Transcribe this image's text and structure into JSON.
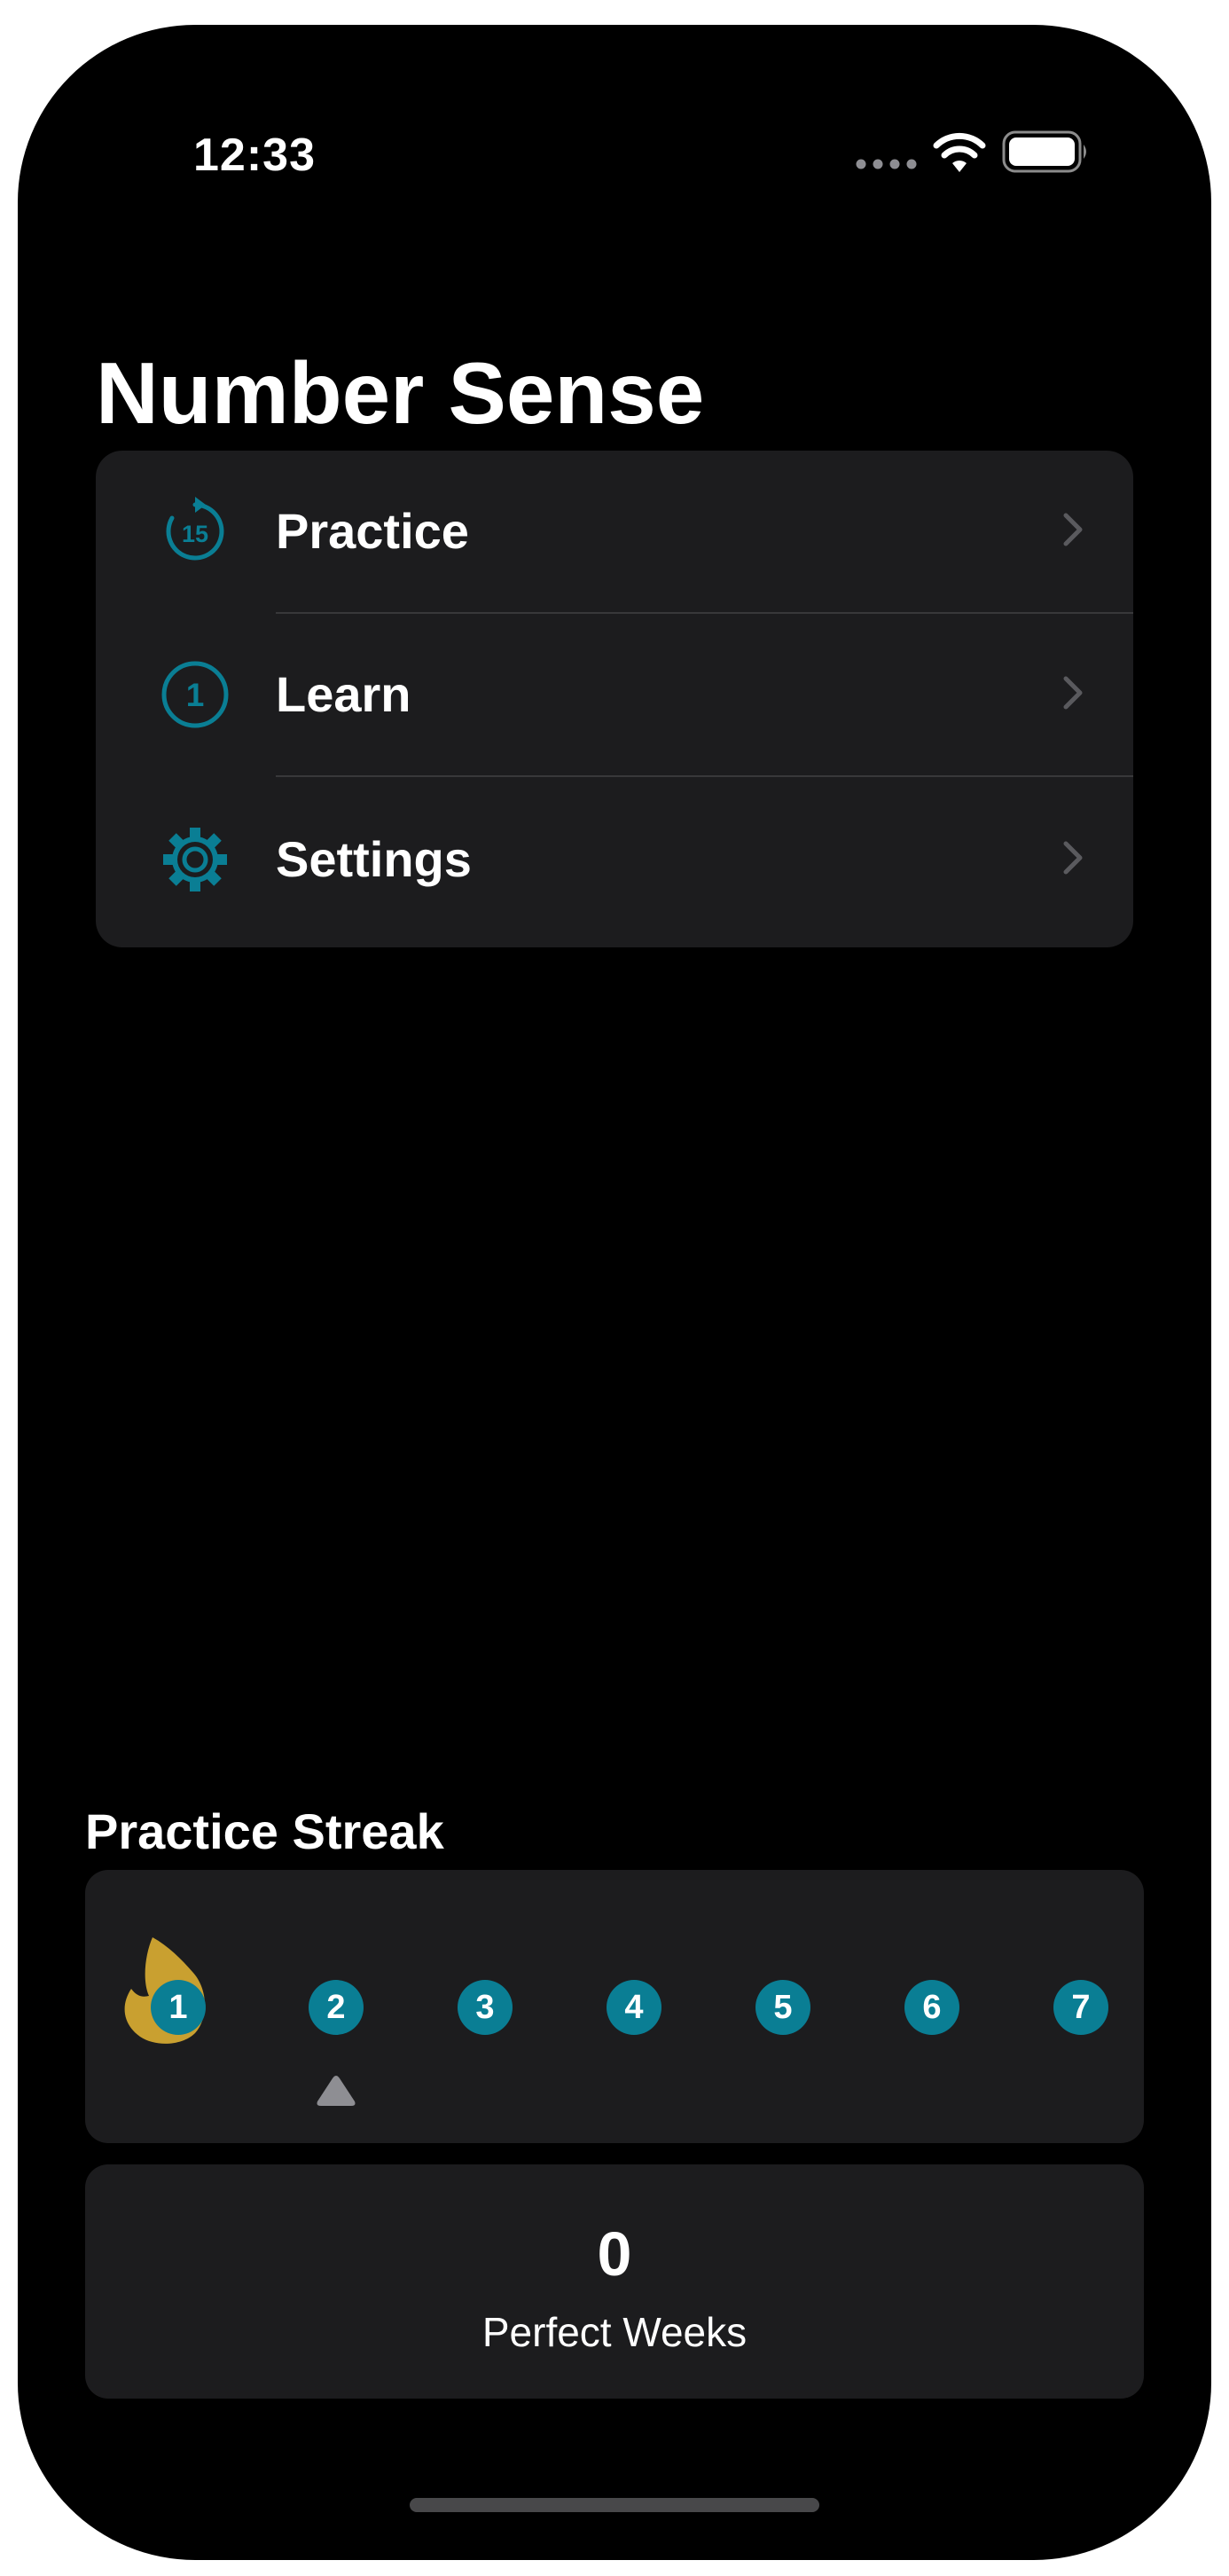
{
  "status_bar": {
    "time": "12:33",
    "icons": [
      "cellular-dots-icon",
      "wifi-icon",
      "battery-icon"
    ]
  },
  "nav": {
    "title": "Number Sense"
  },
  "menu": {
    "items": [
      {
        "label": "Practice",
        "icon": "timer-15-icon",
        "icon_text": "15"
      },
      {
        "label": "Learn",
        "icon": "number-1-circle-icon",
        "icon_text": "1"
      },
      {
        "label": "Settings",
        "icon": "gear-icon"
      }
    ]
  },
  "streak": {
    "title": "Practice Streak",
    "days": [
      "1",
      "2",
      "3",
      "4",
      "5",
      "6",
      "7"
    ],
    "completed_days": [
      1
    ],
    "current_day": 2
  },
  "perfect_weeks": {
    "value": "0",
    "label": "Perfect Weeks"
  },
  "colors": {
    "accent": "#0a7e94",
    "flame": "#c9a030",
    "card": "#1c1c1e",
    "background": "#000000",
    "marker": "#8e8e93"
  }
}
